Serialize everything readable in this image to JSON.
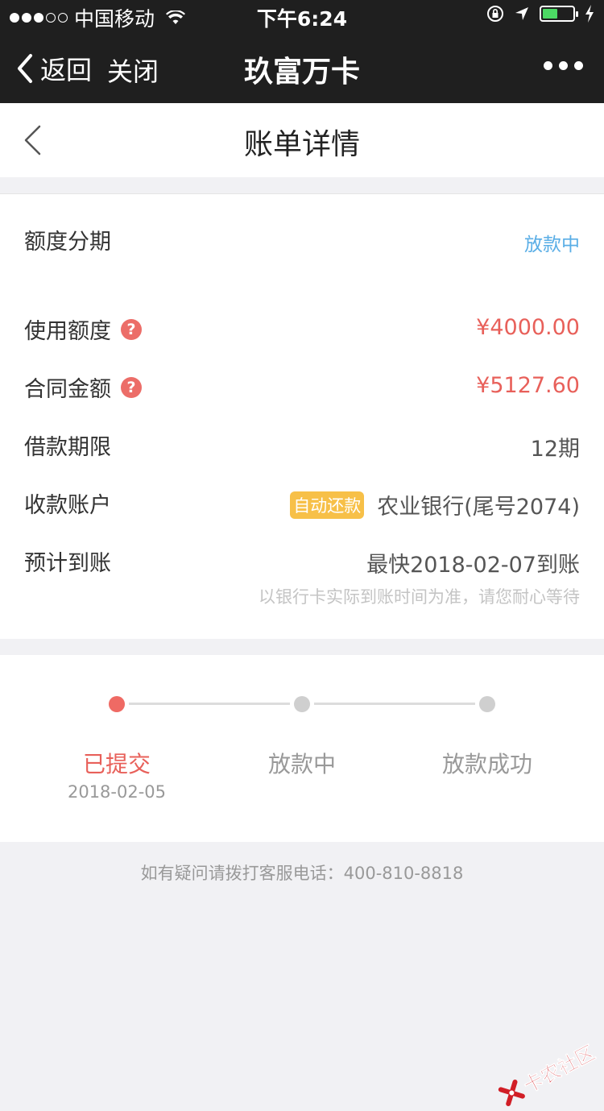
{
  "status_bar": {
    "carrier": "中国移动",
    "time": "下午6:24",
    "battery_level": 0.5,
    "colors": {
      "battery_fill": "#4cd964"
    }
  },
  "nav": {
    "back_label": "返回",
    "close_label": "关闭",
    "title": "玖富万卡"
  },
  "header": {
    "title": "账单详情"
  },
  "summary": {
    "type_label": "额度分期",
    "status": "放款中"
  },
  "details": {
    "used_quota_label": "使用额度",
    "used_quota_value": "¥4000.00",
    "contract_amount_label": "合同金额",
    "contract_amount_value": "¥5127.60",
    "term_label": "借款期限",
    "term_value": "12期",
    "account_label": "收款账户",
    "auto_repay_tag": "自动还款",
    "account_value": "农业银行(尾号2074)",
    "eta_label": "预计到账",
    "eta_value": "最快2018-02-07到账",
    "eta_hint": "以银行卡实际到账时间为准，请您耐心等待",
    "help_glyph": "?"
  },
  "progress": {
    "steps": [
      {
        "label": "已提交",
        "date": "2018-02-05",
        "active": true
      },
      {
        "label": "放款中",
        "date": "",
        "active": false
      },
      {
        "label": "放款成功",
        "date": "",
        "active": false
      }
    ]
  },
  "footer": {
    "note": "如有疑问请拨打客服电话：400-810-8818"
  },
  "watermark": {
    "text": "卡农社区"
  },
  "colors": {
    "accent_red": "#e8605a",
    "status_blue": "#5aaee6",
    "tag_yellow": "#f7c048",
    "bar_dark": "#1f1f1f"
  }
}
